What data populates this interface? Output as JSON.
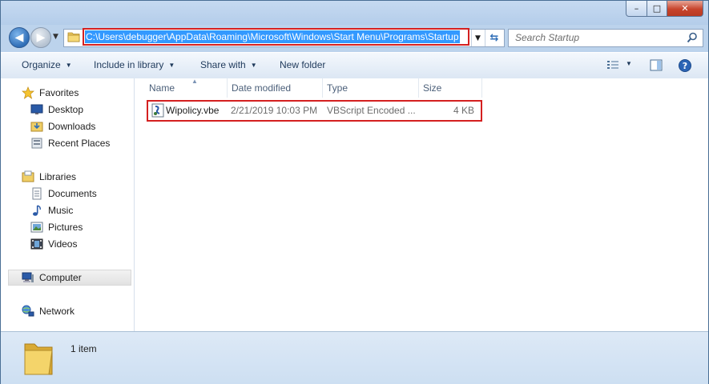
{
  "window": {
    "controls": {
      "minimize": "–",
      "maximize": "□",
      "close": "✕"
    }
  },
  "nav": {
    "back_glyph": "◀",
    "forward_glyph": "▶",
    "address": "C:\\Users\\debugger\\AppData\\Roaming\\Microsoft\\Windows\\Start Menu\\Programs\\Startup",
    "search_placeholder": "Search Startup"
  },
  "toolbar": {
    "organize": "Organize",
    "include_in_library": "Include in library",
    "share_with": "Share with",
    "new_folder": "New folder"
  },
  "sidebar": {
    "favorites": {
      "label": "Favorites",
      "items": [
        "Desktop",
        "Downloads",
        "Recent Places"
      ]
    },
    "libraries": {
      "label": "Libraries",
      "items": [
        "Documents",
        "Music",
        "Pictures",
        "Videos"
      ]
    },
    "computer": "Computer",
    "network": "Network"
  },
  "columns": [
    "Name",
    "Date modified",
    "Type",
    "Size"
  ],
  "files": [
    {
      "name": "Wipolicy.vbe",
      "date_modified": "2/21/2019 10:03 PM",
      "type": "VBScript Encoded ...",
      "size": "4 KB"
    }
  ],
  "status": {
    "item_count": "1 item"
  },
  "colors": {
    "highlight_border": "#d42020",
    "selection": "#3399ff",
    "frame": "#bcd3ec"
  }
}
